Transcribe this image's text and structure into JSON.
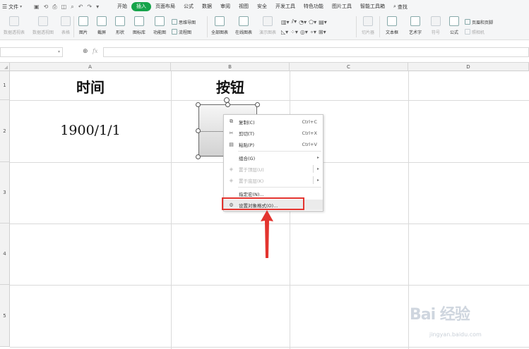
{
  "menubar": {
    "file": "文件",
    "tabs": [
      "开始",
      "插入",
      "页面布局",
      "公式",
      "数据",
      "审阅",
      "视图",
      "安全",
      "开发工具",
      "特色功能",
      "图片工具",
      "智能工具箱"
    ],
    "active_tab": "插入",
    "search": "查找"
  },
  "ribbon": {
    "pivot_table": "数据透视表",
    "pivot_chart": "数据透视图",
    "table": "表格",
    "picture": "图片",
    "screenshot": "截屏",
    "shape": "形状",
    "icon_lib": "图标库",
    "func_chart": "功能图",
    "mindmap": "思维导图",
    "flowchart": "流程图",
    "all_charts": "全部图表",
    "online_chart": "在线图表",
    "demo_chart": "演示图表",
    "slicer": "切片器",
    "textbox": "文本框",
    "art_text": "艺术字",
    "symbol": "符号",
    "formula": "公式",
    "header_footer": "页眉和页脚",
    "camera": "照相机"
  },
  "formula": {
    "fx": "fx"
  },
  "columns": [
    "A",
    "B",
    "C",
    "D"
  ],
  "rows": [
    "1",
    "2",
    "3",
    "4",
    "5"
  ],
  "cells": {
    "a1": "时间",
    "b1": "按钮",
    "a2": "1900/1/1"
  },
  "context_menu": {
    "copy": "复制(C)",
    "copy_sc": "Ctrl+C",
    "cut": "剪切(T)",
    "cut_sc": "Ctrl+X",
    "paste": "粘贴(P)",
    "paste_sc": "Ctrl+V",
    "group": "组合(G)",
    "bring_front": "置于顶层(U)",
    "send_back": "置于底层(K)",
    "assign_macro": "指定宏(N)...",
    "format_object": "设置对象格式(O)..."
  },
  "watermark": {
    "brand": "Bai 经验",
    "url": "jingyan.baidu.com"
  },
  "colors": {
    "active_tab": "#16a34a",
    "highlight_box": "#e3342f"
  }
}
